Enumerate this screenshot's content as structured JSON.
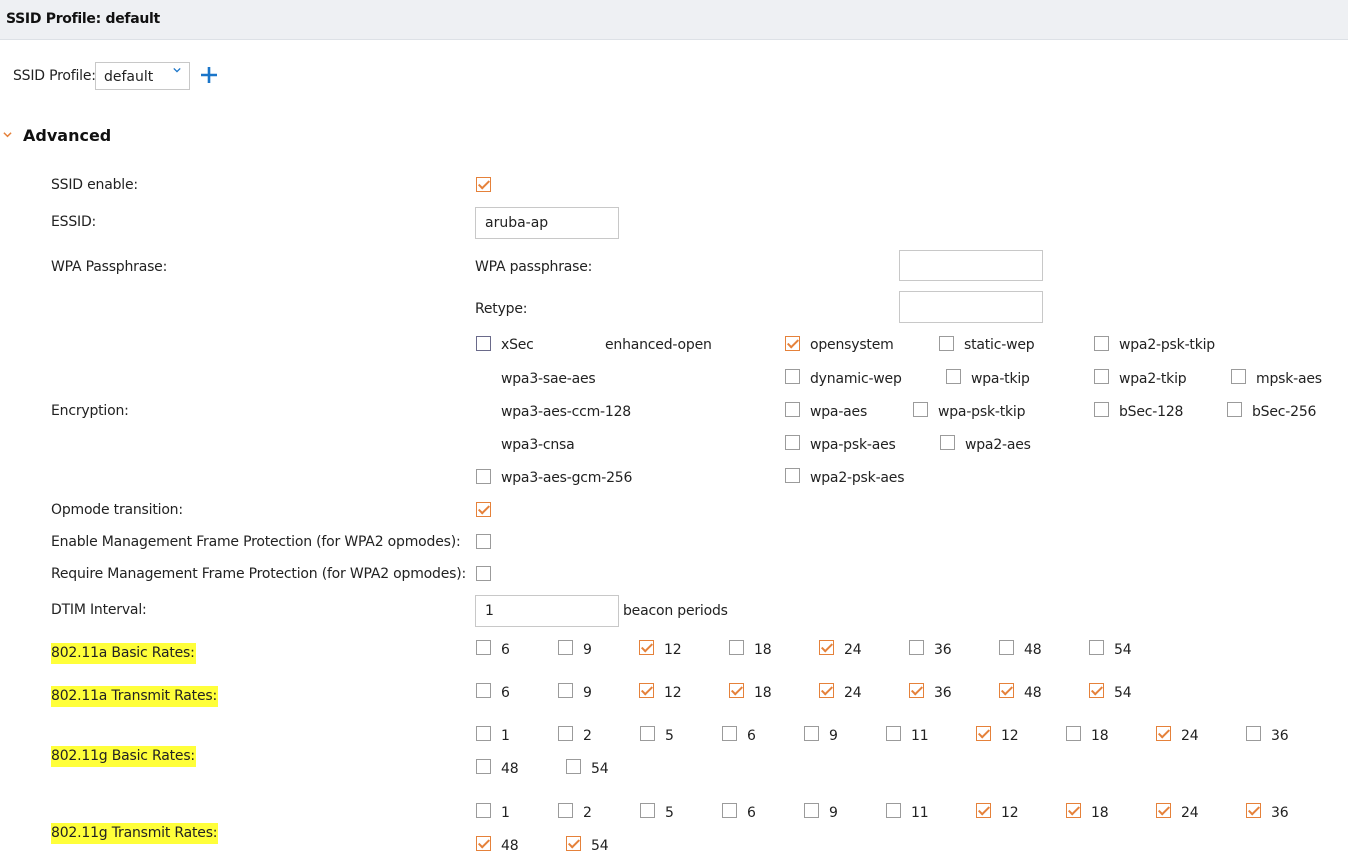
{
  "header": {
    "title": "SSID Profile: default"
  },
  "profile_select": {
    "label": "SSID Profile:",
    "value": "default"
  },
  "advanced": {
    "title": "Advanced"
  },
  "fields": {
    "ssid_enable": {
      "label": "SSID enable:",
      "checked": true
    },
    "essid": {
      "label": "ESSID:",
      "value": "aruba-ap"
    },
    "wpa_passphrase": {
      "label": "WPA Passphrase:",
      "sub_label": "WPA passphrase:",
      "retype_label": "Retype:"
    },
    "encryption": {
      "label": "Encryption:"
    },
    "opmode_transition": {
      "label": "Opmode transition:",
      "checked": true
    },
    "enable_mfp": {
      "label": "Enable Management Frame Protection (for WPA2 opmodes):",
      "checked": false
    },
    "require_mfp": {
      "label": "Require Management Frame Protection (for WPA2 opmodes):",
      "checked": false
    },
    "dtim": {
      "label": "DTIM Interval:",
      "value": "1",
      "unit": "beacon periods"
    }
  },
  "encryption_options": [
    {
      "name": "xSec",
      "checked": false,
      "has_checkbox": true
    },
    {
      "name": "enhanced-open",
      "checked": false,
      "has_checkbox": false
    },
    {
      "name": "opensystem",
      "checked": true,
      "has_checkbox": true
    },
    {
      "name": "static-wep",
      "checked": false,
      "has_checkbox": true
    },
    {
      "name": "wpa2-psk-tkip",
      "checked": false,
      "has_checkbox": true
    },
    {
      "name": "wpa3-sae-aes",
      "checked": false,
      "has_checkbox": false
    },
    {
      "name": "dynamic-wep",
      "checked": false,
      "has_checkbox": true
    },
    {
      "name": "wpa-tkip",
      "checked": false,
      "has_checkbox": true
    },
    {
      "name": "wpa2-tkip",
      "checked": false,
      "has_checkbox": true
    },
    {
      "name": "mpsk-aes",
      "checked": false,
      "has_checkbox": true
    },
    {
      "name": "wpa3-aes-ccm-128",
      "checked": false,
      "has_checkbox": false
    },
    {
      "name": "wpa-aes",
      "checked": false,
      "has_checkbox": true
    },
    {
      "name": "wpa-psk-tkip",
      "checked": false,
      "has_checkbox": true
    },
    {
      "name": "bSec-128",
      "checked": false,
      "has_checkbox": true
    },
    {
      "name": "bSec-256",
      "checked": false,
      "has_checkbox": true
    },
    {
      "name": "wpa3-cnsa",
      "checked": false,
      "has_checkbox": false
    },
    {
      "name": "wpa-psk-aes",
      "checked": false,
      "has_checkbox": true
    },
    {
      "name": "wpa2-aes",
      "checked": false,
      "has_checkbox": true
    },
    {
      "name": "wpa3-aes-gcm-256",
      "checked": false,
      "has_checkbox": true
    },
    {
      "name": "wpa2-psk-aes",
      "checked": false,
      "has_checkbox": true
    }
  ],
  "rates": {
    "a_basic": {
      "label": "802.11a Basic Rates:",
      "options": [
        {
          "v": "6",
          "c": false
        },
        {
          "v": "9",
          "c": false
        },
        {
          "v": "12",
          "c": true
        },
        {
          "v": "18",
          "c": false
        },
        {
          "v": "24",
          "c": true
        },
        {
          "v": "36",
          "c": false
        },
        {
          "v": "48",
          "c": false
        },
        {
          "v": "54",
          "c": false
        }
      ]
    },
    "a_transmit": {
      "label": "802.11a Transmit Rates:",
      "options": [
        {
          "v": "6",
          "c": false
        },
        {
          "v": "9",
          "c": false
        },
        {
          "v": "12",
          "c": true
        },
        {
          "v": "18",
          "c": true
        },
        {
          "v": "24",
          "c": true
        },
        {
          "v": "36",
          "c": true
        },
        {
          "v": "48",
          "c": true
        },
        {
          "v": "54",
          "c": true
        }
      ]
    },
    "g_basic": {
      "label": "802.11g Basic Rates:",
      "options": [
        {
          "v": "1",
          "c": false
        },
        {
          "v": "2",
          "c": false
        },
        {
          "v": "5",
          "c": false
        },
        {
          "v": "6",
          "c": false
        },
        {
          "v": "9",
          "c": false
        },
        {
          "v": "11",
          "c": false
        },
        {
          "v": "12",
          "c": true
        },
        {
          "v": "18",
          "c": false
        },
        {
          "v": "24",
          "c": true
        },
        {
          "v": "36",
          "c": false
        },
        {
          "v": "48",
          "c": false
        },
        {
          "v": "54",
          "c": false
        }
      ]
    },
    "g_transmit": {
      "label": "802.11g Transmit Rates:",
      "options": [
        {
          "v": "1",
          "c": false
        },
        {
          "v": "2",
          "c": false
        },
        {
          "v": "5",
          "c": false
        },
        {
          "v": "6",
          "c": false
        },
        {
          "v": "9",
          "c": false
        },
        {
          "v": "11",
          "c": false
        },
        {
          "v": "12",
          "c": true
        },
        {
          "v": "18",
          "c": true
        },
        {
          "v": "24",
          "c": true
        },
        {
          "v": "36",
          "c": true
        },
        {
          "v": "48",
          "c": true
        },
        {
          "v": "54",
          "c": true
        }
      ]
    }
  },
  "colors": {
    "accent": "#e5813a",
    "highlight": "#ffff3a",
    "plus": "#1a75c9"
  }
}
